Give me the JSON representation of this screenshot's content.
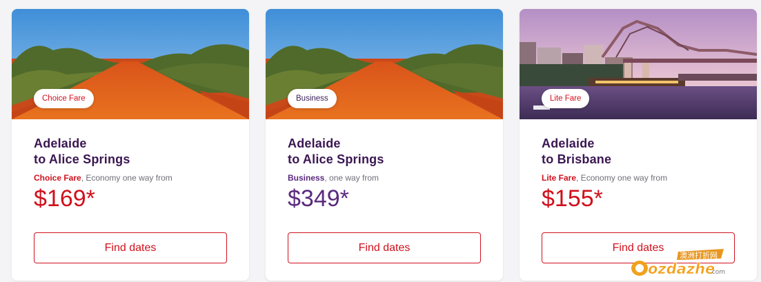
{
  "cards": [
    {
      "badge": "Choice Fare",
      "route_line1": "Adelaide",
      "route_line2": "to Alice Springs",
      "fare_name": "Choice Fare",
      "fare_suffix": ", Economy one way from",
      "price": "$169*",
      "button": "Find dates",
      "image": "outback-red-dirt-road"
    },
    {
      "badge": "Business",
      "route_line1": "Adelaide",
      "route_line2": "to Alice Springs",
      "fare_name": "Business",
      "fare_suffix": ", one way from",
      "price": "$349*",
      "button": "Find dates",
      "image": "outback-red-dirt-road"
    },
    {
      "badge": "Lite Fare",
      "route_line1": "Adelaide",
      "route_line2": "to Brisbane",
      "fare_name": "Lite Fare",
      "fare_suffix": ", Economy one way from",
      "price": "$155*",
      "button": "Find dates",
      "image": "brisbane-story-bridge-dusk"
    }
  ],
  "watermark": {
    "top": "澳洲打折网",
    "main": "ozdazhe",
    "suffix": ".com"
  },
  "colors": {
    "brand_red": "#d0101c",
    "brand_purple": "#5a2a7e",
    "heading_purple": "#3a1652"
  }
}
